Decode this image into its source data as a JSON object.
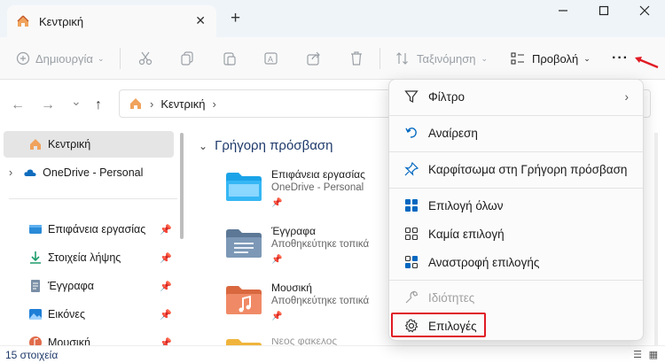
{
  "titlebar": {
    "tab_label": "Κεντρική",
    "close_glyph": "✕",
    "newtab_glyph": "+",
    "window_controls": [
      "—",
      "☐",
      "✕"
    ]
  },
  "toolbar": {
    "new_label": "Δημιουργία",
    "sort_label": "Ταξινόμηση",
    "view_label": "Προβολή",
    "more_glyph": "···"
  },
  "nav": {
    "back": "←",
    "forward": "→",
    "recent": "⌄",
    "up": "↑",
    "address": "Κεντρική"
  },
  "sidebar": {
    "items": [
      {
        "label": "Κεντρική",
        "icon": "home-icon"
      },
      {
        "label": "OneDrive - Personal",
        "icon": "cloud-icon"
      },
      {
        "label": "Επιφάνεια εργασίας",
        "icon": "desktop-icon"
      },
      {
        "label": "Στοιχεία λήψης",
        "icon": "download-icon"
      },
      {
        "label": "Έγγραφα",
        "icon": "document-icon"
      },
      {
        "label": "Εικόνες",
        "icon": "picture-icon"
      },
      {
        "label": "Μουσική",
        "icon": "music-icon"
      }
    ]
  },
  "main": {
    "section_title": "Γρήγορη πρόσβαση",
    "items": [
      {
        "name": "Επιφάνεια εργασίας",
        "sub": "OneDrive - Personal"
      },
      {
        "name": "Έγγραφα",
        "sub": "Αποθηκεύτηκε τοπικά"
      },
      {
        "name": "Μουσική",
        "sub": "Αποθηκεύτηκε τοπικά"
      },
      {
        "name": "Νέος φάκελος",
        "sub": ""
      }
    ]
  },
  "status": {
    "count": "15 στοιχεία"
  },
  "menu": {
    "items": [
      {
        "label": "Φίλτρο",
        "icon": "filter-icon",
        "disabled": false
      },
      {
        "label": "Αναίρεση",
        "icon": "undo-icon",
        "disabled": false
      },
      {
        "label": "Καρφίτσωμα στη Γρήγορη πρόσβαση",
        "icon": "pin-icon",
        "disabled": false
      },
      {
        "label": "Επιλογή όλων",
        "icon": "select-all-icon",
        "disabled": false
      },
      {
        "label": "Καμία επιλογή",
        "icon": "select-none-icon",
        "disabled": false
      },
      {
        "label": "Αναστροφή επιλογής",
        "icon": "invert-selection-icon",
        "disabled": false
      },
      {
        "label": "Ιδιότητες",
        "icon": "properties-icon",
        "disabled": true
      },
      {
        "label": "Επιλογές",
        "icon": "options-gear-icon",
        "disabled": false
      }
    ]
  },
  "colors": {
    "accent": "#0067c0",
    "highlight": "#e01b24",
    "folder": "#f0b43c"
  }
}
